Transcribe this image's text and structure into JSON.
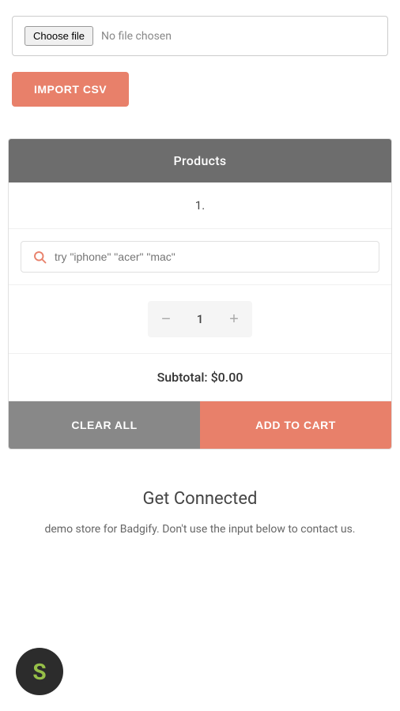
{
  "file_section": {
    "choose_file_label": "Choose file",
    "no_file_label": "No file chosen",
    "import_btn_label": "IMPORT CSV"
  },
  "products_section": {
    "header_label": "Products",
    "product_number": "1.",
    "search_placeholder": "try \"iphone\" \"acer\" \"mac\"",
    "quantity_value": "1",
    "subtotal_label": "Subtotal: $0.00",
    "clear_all_label": "CLEAR ALL",
    "add_to_cart_label": "ADD TO CART"
  },
  "get_connected": {
    "title": "Get Connected",
    "description": "demo store for Badgify. Don't use the input below to contact us."
  },
  "colors": {
    "accent": "#e8806a",
    "header_bg": "#6d6d6d",
    "gray_btn": "#888888"
  }
}
